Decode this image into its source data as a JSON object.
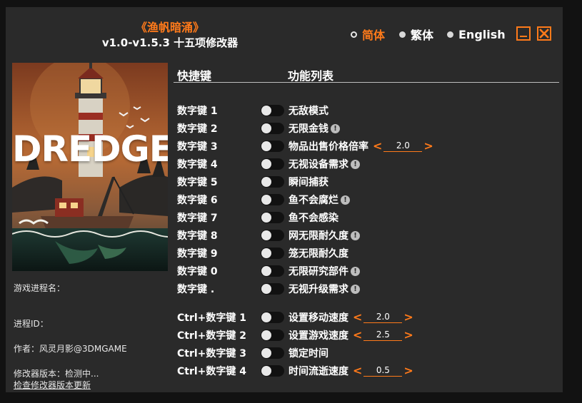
{
  "title": {
    "game": "《渔帆暗涌》",
    "version": "v1.0-v1.5.3 十五项修改器"
  },
  "languages": [
    {
      "label": "简体",
      "selected": true
    },
    {
      "label": "繁体",
      "selected": false
    },
    {
      "label": "English",
      "selected": false
    }
  ],
  "window_controls": {
    "minimize_icon": "minimize-icon",
    "close_icon": "close-icon"
  },
  "cover": {
    "title": "DREDGE"
  },
  "info": {
    "process_name": "游戏进程名：",
    "process_id": "进程ID：",
    "author": "作者：风灵月影@3DMGAME",
    "trainer_version": "修改器版本：检测中...",
    "check_update": "检查修改器版本更新"
  },
  "headers": {
    "hotkey": "快捷键",
    "functions": "功能列表"
  },
  "cheats": [
    {
      "key": "数字键 1",
      "label": "无敌模式",
      "warn": false
    },
    {
      "key": "数字键 2",
      "label": "无限金钱",
      "warn": true
    },
    {
      "key": "数字键 3",
      "label": "物品出售价格倍率",
      "warn": false,
      "value": "2.0"
    },
    {
      "key": "数字键 4",
      "label": "无视设备需求",
      "warn": true
    },
    {
      "key": "数字键 5",
      "label": "瞬间捕获",
      "warn": false
    },
    {
      "key": "数字键 6",
      "label": "鱼不会腐烂",
      "warn": true
    },
    {
      "key": "数字键 7",
      "label": "鱼不会感染",
      "warn": false
    },
    {
      "key": "数字键 8",
      "label": "网无限耐久度",
      "warn": true
    },
    {
      "key": "数字键 9",
      "label": "笼无限耐久度",
      "warn": false
    },
    {
      "key": "数字键 0",
      "label": "无限研究部件",
      "warn": true
    },
    {
      "key": "数字键 .",
      "label": "无视升级需求",
      "warn": true
    },
    {
      "key": "Ctrl+数字键 1",
      "label": "设置移动速度",
      "warn": false,
      "value": "2.0"
    },
    {
      "key": "Ctrl+数字键 2",
      "label": "设置游戏速度",
      "warn": false,
      "value": "2.5"
    },
    {
      "key": "Ctrl+数字键 3",
      "label": "锁定时间",
      "warn": false
    },
    {
      "key": "Ctrl+数字键 4",
      "label": "时间流逝速度",
      "warn": false,
      "value": "0.5"
    }
  ],
  "colors": {
    "accent": "#ff7a1a",
    "panel": "#2a2a2a",
    "toggle_track": "#111111",
    "toggle_knob": "#e8e8e8"
  }
}
